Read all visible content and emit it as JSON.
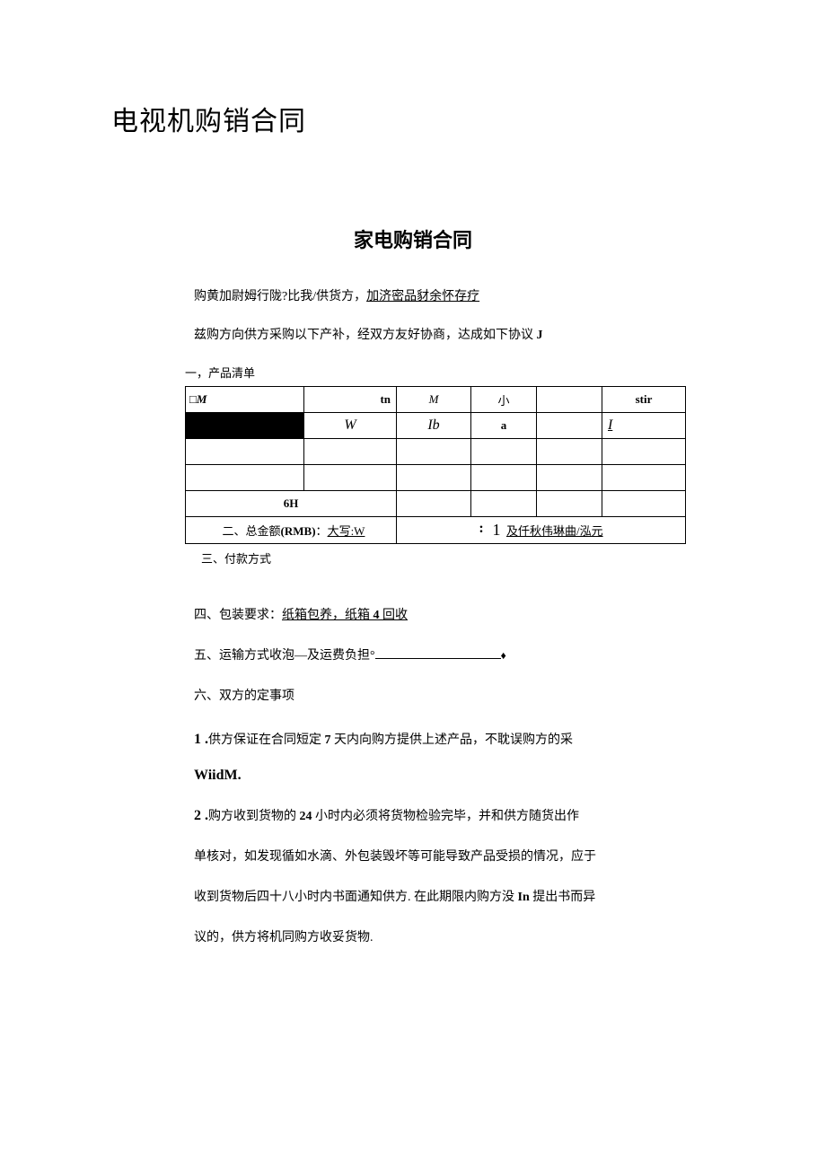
{
  "title_main": "电视机购销合同",
  "title_sub": "家电购销合同",
  "intro_line1_a": "购黄加尉姆行陇?比我/供货方，",
  "intro_line1_b": "加济密品豺余怀存疗",
  "intro_line2_a": "兹购方向供方采购以下产补，经双方友好协商，达成如下协议 ",
  "intro_line2_b": "J",
  "section1": "一，产品清单",
  "hdr_c1": "□M",
  "hdr_c2": "tn",
  "hdr_c3": "M",
  "hdr_c4": "小",
  "hdr_c5": "",
  "hdr_c6": "stir",
  "row2_c2": "W",
  "row2_c3": "Ib",
  "row2_c4": "a",
  "row2_c6": "I",
  "row5_c1": "6H",
  "amount_left_a": "二、总金额",
  "amount_left_b": "(RMB)",
  "amount_left_c": "：",
  "amount_left_d": "大写:W",
  "amount_right_colon": ":",
  "amount_right_one": "1",
  "amount_right_text": "及仟秋伟琳曲/泓元",
  "section3": "三、付款方式",
  "section4_a": "四、包装要求：",
  "section4_b": "纸箱包养，纸箱",
  "section4_c": " 4 ",
  "section4_d": "回收",
  "section5_a": "五、运输方式收泡—及运费负担°",
  "section5_star": "♦",
  "section6": "六、双方的定事项",
  "clause1_a": "1 .",
  "clause1_b": "供方保证在合同短定 ",
  "clause1_c": "7",
  "clause1_d": " 天内向购方提供上述产品，不耽误购方的采",
  "wiidm": "WiidM.",
  "clause2_a": "2 .",
  "clause2_b": "购方收到货物的 ",
  "clause2_c": "24",
  "clause2_d": " 小时内必须将货物检验完毕，并和供方随货出作",
  "clause2_e": "单核对，如发现循如水滴、外包装毁坏等可能导致产品受损的情况，应于",
  "clause2_f": "收到货物后四十八小时内书面通知供方. 在此期限内购方没 ",
  "clause2_g": "In",
  "clause2_h": " 提出书而异",
  "clause2_i": "议的，供方将机同购方收妥货物."
}
